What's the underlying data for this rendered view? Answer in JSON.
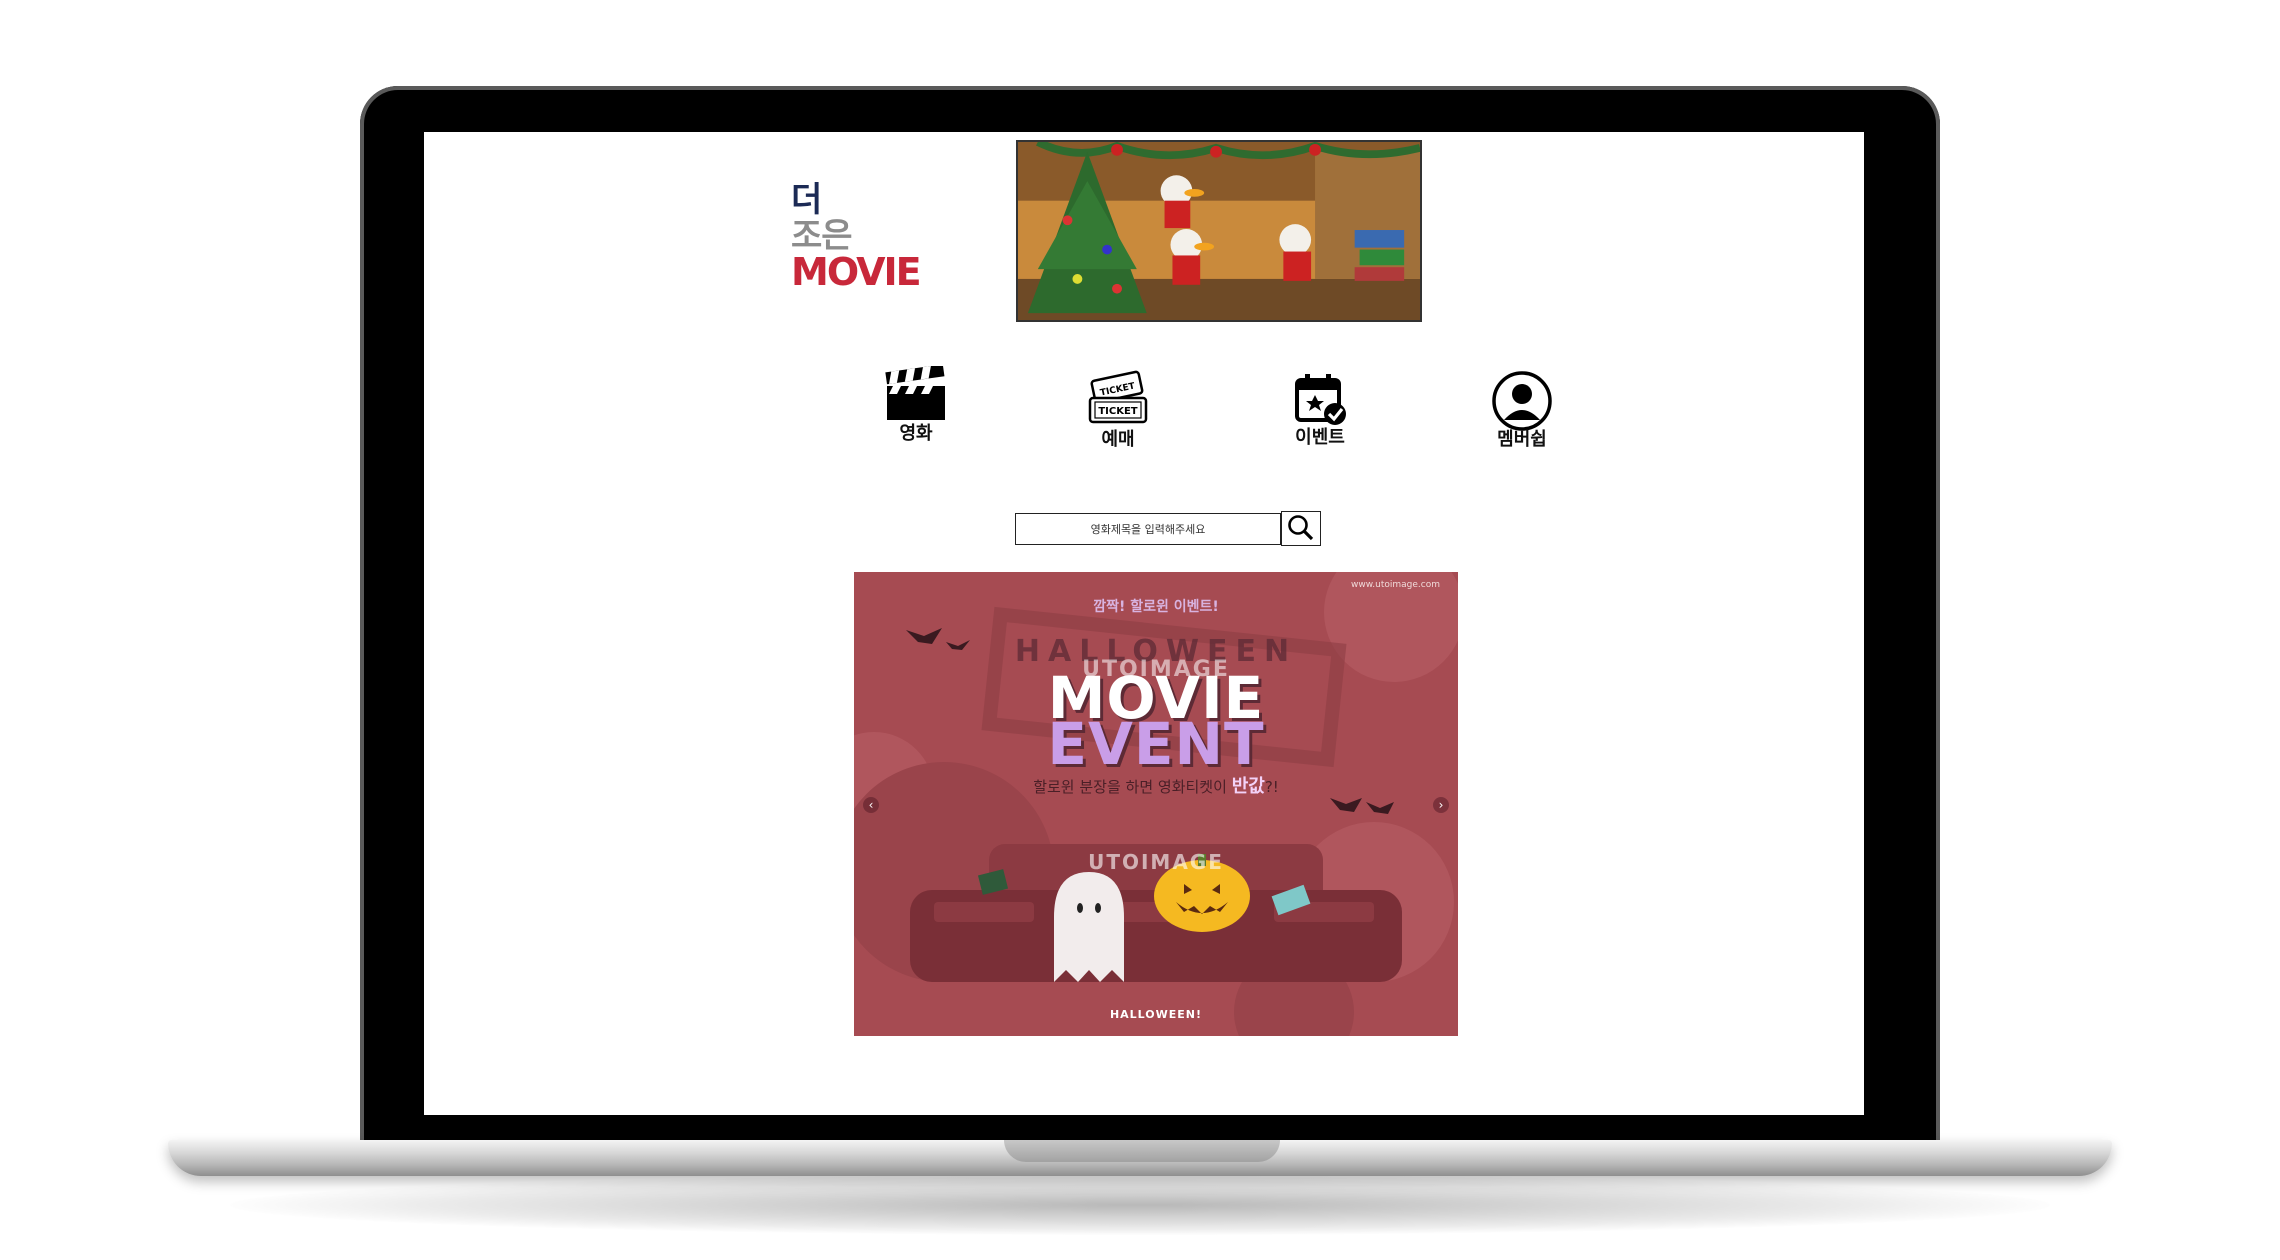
{
  "logo": {
    "line1": "더",
    "line2": "조은",
    "line3": "MOVIE"
  },
  "nav": {
    "movie": "영화",
    "booking": "예매",
    "event": "이벤트",
    "membership": "멤버쉽"
  },
  "ticket_icon": {
    "top": "TICKET",
    "bottom": "TICKET"
  },
  "search": {
    "placeholder": "영화제목을 입력해주세요"
  },
  "event_banner": {
    "kicker": "깜짝! 할로윈 이벤트!",
    "url": "www.utoimage.com",
    "halloween": "HALLOWEEN",
    "watermark": "UTOIMAGE",
    "title_line1": "MOVIE",
    "title_line2": "EVENT",
    "subtitle": "할로윈 분장을 하면 영화티켓이",
    "subtitle_highlight": "반값",
    "subtitle_end": "?!",
    "footer": "HALLOWEEN!",
    "prev_arrow": "‹",
    "next_arrow": "›"
  },
  "colors": {
    "logo_navy": "#1b2a55",
    "logo_gray": "#8c8c8c",
    "logo_red": "#c8283a",
    "event_bg": "#a64b52"
  }
}
